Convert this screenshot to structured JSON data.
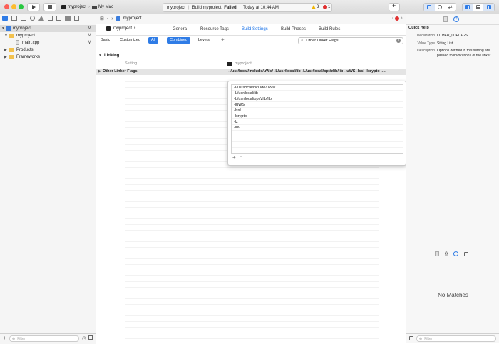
{
  "toolbar": {
    "scheme_name": "myproject",
    "destination": "My Mac",
    "status": {
      "project": "myproject",
      "message_prefix": "Build myproject:",
      "message_state": "Failed",
      "timestamp": "Today at 10:44 AM",
      "warning_count": "3",
      "error_count": "1"
    }
  },
  "navigator": {
    "items": [
      {
        "label": "myproject",
        "badge": "M"
      },
      {
        "label": "myproject",
        "badge": "M"
      },
      {
        "label": "main.cpp",
        "badge": "M"
      },
      {
        "label": "Products",
        "badge": ""
      },
      {
        "label": "Frameworks",
        "badge": ""
      }
    ],
    "filter_placeholder": "Filter"
  },
  "jumpbar": {
    "crumb": "myproject",
    "error_count": "1"
  },
  "editor": {
    "target_selector": "myproject",
    "tabs": [
      "General",
      "Resource Tags",
      "Build Settings",
      "Build Phases",
      "Build Rules"
    ],
    "active_tab": "Build Settings",
    "filters": [
      "Basic",
      "Customized",
      "All",
      "Combined",
      "Levels"
    ],
    "search_value": "Other Linker Flags",
    "section": "Linking",
    "column_setting": "Setting",
    "column_target": "myproject",
    "row_name": "Other Linker Flags",
    "row_value": "-I/usr/local/include/uWs/ -L/usr/local/lib -L/usr/local/opt/zlib/lib -luWS -lssl -lcrypto -..."
  },
  "popover": {
    "entries": [
      "-I/usr/local/include/uWs/",
      "-L/usr/local/lib",
      "-L/usr/local/opt/zlib/lib",
      "-luWS",
      "-lssl",
      "-lcrypto",
      "-lz",
      "-luv"
    ],
    "add_label": "+",
    "remove_label": "−"
  },
  "inspector": {
    "title": "Quick Help",
    "declaration_label": "Declaration",
    "declaration_value": "OTHER_LDFLAGS",
    "value_type_label": "Value Type",
    "value_type_value": "String List",
    "description_label": "Description",
    "description_value": "Options defined in this setting are passed to invocations of the linker.",
    "library_empty": "No Matches",
    "filter_placeholder": "Filter"
  },
  "colors": {
    "accent": "#2f7ce6",
    "error": "#e03030",
    "warning": "#f0b400",
    "folder": "#f2c14e"
  }
}
